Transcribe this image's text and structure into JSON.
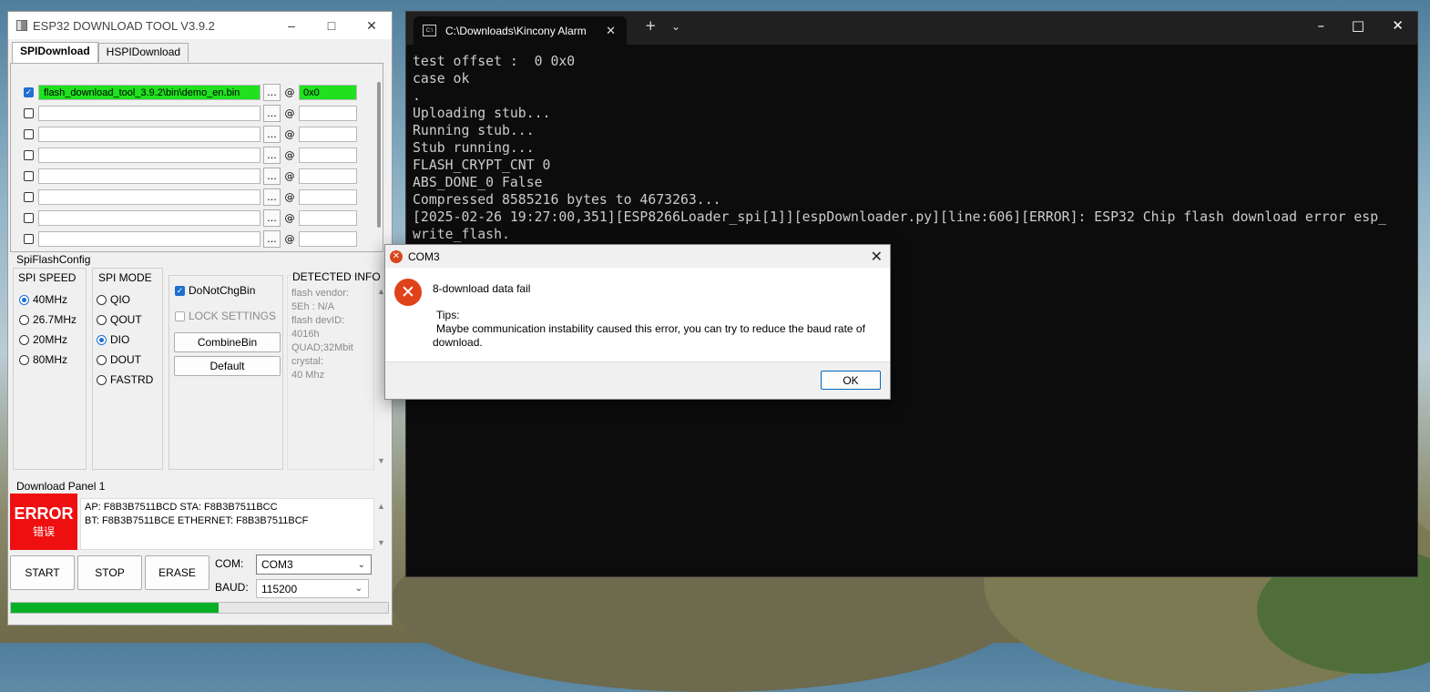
{
  "tool": {
    "title": "ESP32 DOWNLOAD TOOL V3.9.2",
    "tabs": [
      "SPIDownload",
      "HSPIDownload"
    ],
    "files": [
      {
        "checked": true,
        "path": "flash_download_tool_3.9.2\\bin\\demo_en.bin",
        "addr": "0x0"
      },
      {
        "checked": false,
        "path": "",
        "addr": ""
      },
      {
        "checked": false,
        "path": "",
        "addr": ""
      },
      {
        "checked": false,
        "path": "",
        "addr": ""
      },
      {
        "checked": false,
        "path": "",
        "addr": ""
      },
      {
        "checked": false,
        "path": "",
        "addr": ""
      },
      {
        "checked": false,
        "path": "",
        "addr": ""
      },
      {
        "checked": false,
        "path": "",
        "addr": ""
      }
    ],
    "browse_label": "...",
    "at_label": "@",
    "spi_flash_config": "SpiFlashConfig",
    "spi_speed": {
      "label": "SPI SPEED",
      "options": [
        "40MHz",
        "26.7MHz",
        "20MHz",
        "80MHz"
      ],
      "selected": "40MHz"
    },
    "spi_mode": {
      "label": "SPI MODE",
      "options": [
        "QIO",
        "QOUT",
        "DIO",
        "DOUT",
        "FASTRD"
      ],
      "selected": "DIO"
    },
    "do_not_chg_bin": "DoNotChgBin",
    "lock_settings": "LOCK SETTINGS",
    "combine_bin": "CombineBin",
    "default_btn": "Default",
    "detected_info": {
      "label": "DETECTED INFO",
      "lines": [
        "flash vendor:",
        "5Eh : N/A",
        "flash devID:",
        "4016h",
        "QUAD;32Mbit",
        "crystal:",
        "40 Mhz"
      ]
    },
    "download_panel": "Download Panel 1",
    "status": {
      "en": "ERROR",
      "cn": "错误"
    },
    "mac_lines": [
      "AP:  F8B3B7511BCD  STA:  F8B3B7511BCC",
      "BT:  F8B3B7511BCE  ETHERNET:  F8B3B7511BCF"
    ],
    "start": "START",
    "stop": "STOP",
    "erase": "ERASE",
    "com_label": "COM:",
    "com_value": "COM3",
    "baud_label": "BAUD:",
    "baud_value": "115200",
    "progress": 0.55
  },
  "terminal": {
    "tab_title": "C:\\Downloads\\Kincony Alarm",
    "lines": [
      "test offset :  0 0x0",
      "case ok",
      ".",
      "Uploading stub...",
      "Running stub...",
      "Stub running...",
      "FLASH_CRYPT_CNT 0",
      "ABS_DONE_0 False",
      "Compressed 8585216 bytes to 4673263...",
      "[2025-02-26 19:27:00,351][ESP8266Loader_spi[1]][espDownloader.py][line:606][ERROR]: ESP32 Chip flash download error esp_",
      "write_flash."
    ]
  },
  "dialog": {
    "title": "COM3",
    "message": "8-download data fail",
    "tips_label": "Tips:",
    "tips_text": "Maybe communication instability caused this error, you can try to reduce the baud rate of download.",
    "ok": "OK"
  }
}
